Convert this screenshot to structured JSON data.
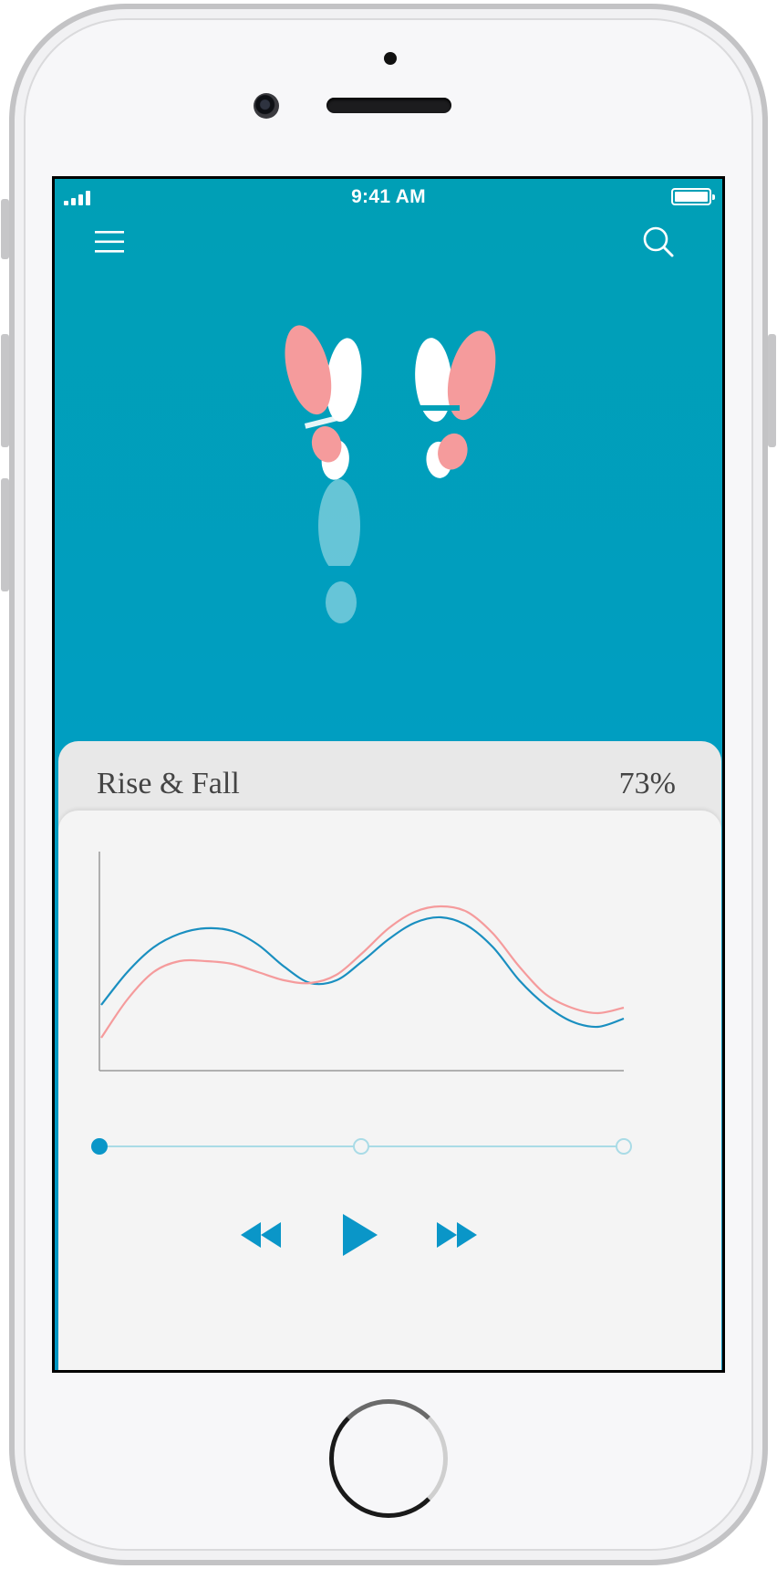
{
  "device": {
    "model": "iPhone"
  },
  "status_bar": {
    "time": "9:41 AM"
  },
  "header": {
    "menu_icon": "hamburger-icon",
    "search_icon": "search-icon"
  },
  "colors": {
    "accent": "#0a96c8",
    "header_bg": "#00a0b8",
    "coral": "#f59b9c",
    "card_head": "#e8e8e8",
    "card_body": "#f4f4f4"
  },
  "card": {
    "title": "Rise & Fall",
    "percent": "73%"
  },
  "chart_data": {
    "type": "line",
    "x": [
      0,
      0.5,
      1,
      1.5,
      2,
      2.5,
      3,
      3.5,
      4,
      4.5,
      5,
      5.5,
      6,
      6.5,
      7,
      7.5,
      8,
      8.5,
      9,
      9.5,
      10
    ],
    "series": [
      {
        "color": "#1a8fc0",
        "values": [
          2.4,
          3.6,
          4.5,
          5.0,
          5.2,
          5.1,
          4.6,
          3.8,
          3.2,
          3.3,
          4.0,
          4.8,
          5.4,
          5.6,
          5.3,
          4.5,
          3.3,
          2.4,
          1.8,
          1.6,
          1.9
        ]
      },
      {
        "color": "#f59b9c",
        "values": [
          1.2,
          2.6,
          3.6,
          4.0,
          4.0,
          3.9,
          3.6,
          3.3,
          3.2,
          3.5,
          4.3,
          5.2,
          5.8,
          6.0,
          5.8,
          5.0,
          3.8,
          2.8,
          2.3,
          2.1,
          2.3
        ]
      }
    ],
    "ylim": [
      0,
      8
    ],
    "grid": false,
    "legend": "none"
  },
  "progress": {
    "steps": 3,
    "active_step": 1
  },
  "player": {
    "rewind_icon": "rewind-icon",
    "play_icon": "play-icon",
    "forward_icon": "fast-forward-icon"
  }
}
